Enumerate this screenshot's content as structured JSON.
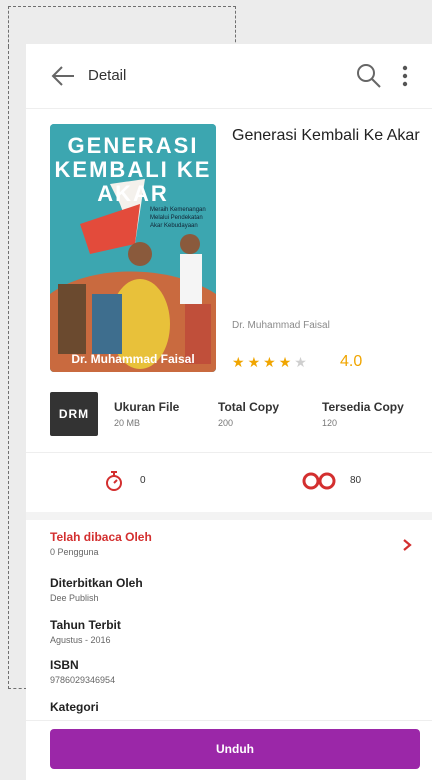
{
  "appbar": {
    "title": "Detail"
  },
  "book": {
    "cover_title": "GENERASI KEMBALI KE AKAR",
    "cover_subtitle": "Meraih Kemenangan Melalui Pendekatan Akar Kebudayaan",
    "cover_author": "Dr. Muhammad Faisal",
    "title": "Generasi Kembali Ke Akar",
    "author": "Dr. Muhammad Faisal",
    "rating_text": "4.0",
    "rating_value": 4,
    "rating_max": 5
  },
  "drm_badge": "DRM",
  "meta": {
    "ukuran": {
      "label": "Ukuran File",
      "value": "20 MB"
    },
    "total": {
      "label": "Total Copy",
      "value": "200"
    },
    "tersedia": {
      "label": "Tersedia Copy",
      "value": "120"
    }
  },
  "stats": {
    "timer_count": "0",
    "readers_count": "80"
  },
  "info": {
    "telah": {
      "label": "Telah dibaca Oleh",
      "value": "0 Pengguna"
    },
    "diterbitkan": {
      "label": "Diterbitkan Oleh",
      "value": "Dee Publish"
    },
    "tahun": {
      "label": "Tahun Terbit",
      "value": "Agustus - 2016"
    },
    "isbn": {
      "label": "ISBN",
      "value": "9786029346954"
    },
    "kategori": {
      "label": "Kategori"
    }
  },
  "actions": {
    "download_label": "Unduh"
  },
  "colors": {
    "accent": "#9b27a8",
    "star": "#f0a500",
    "danger": "#d32f2f"
  }
}
